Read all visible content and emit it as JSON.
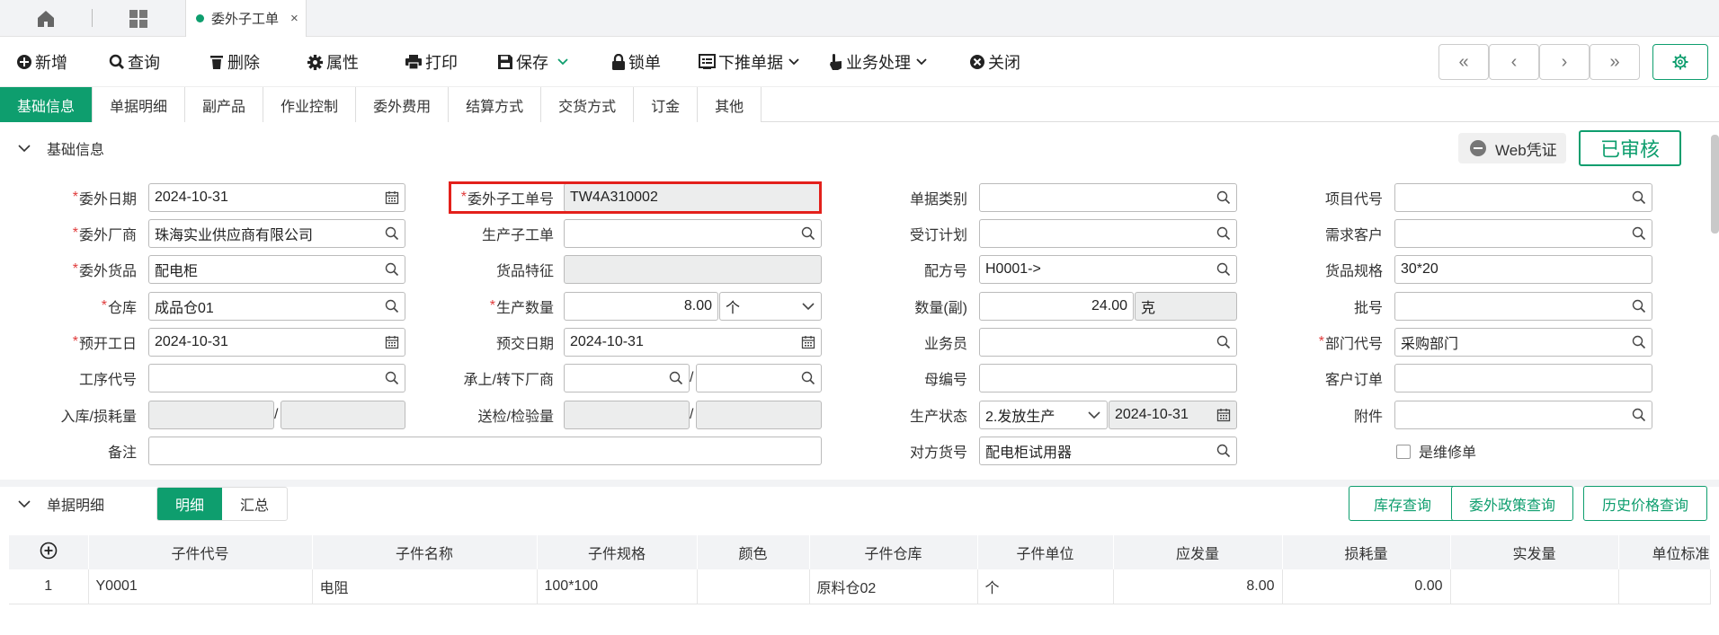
{
  "doc_tab": {
    "label": "委外子工单",
    "close": "×"
  },
  "toolbar": {
    "new": "新增",
    "query": "查询",
    "delete": "删除",
    "properties": "属性",
    "print": "打印",
    "save": "保存",
    "lock": "锁单",
    "push_down": "下推单据",
    "business": "业务处理",
    "close": "关闭"
  },
  "nav": {
    "first": "«",
    "prev": "‹",
    "next": "›",
    "last": "»"
  },
  "tabs": [
    "基础信息",
    "单据明细",
    "副产品",
    "作业控制",
    "委外费用",
    "结算方式",
    "交货方式",
    "订金",
    "其他"
  ],
  "basic": {
    "section_title": "基础信息",
    "web_voucher": "Web凭证",
    "status": "已审核",
    "required_mark": "*",
    "labels": {
      "outsource_date": "委外日期",
      "outsource_vendor": "委外厂商",
      "outsource_goods": "委外货品",
      "warehouse": "仓库",
      "planned_start": "预开工日",
      "process_code": "工序代号",
      "in_loss_qty": "入库/损耗量",
      "remark": "备注",
      "sub_order_no": "委外子工单号",
      "production_sub_order": "生产子工单",
      "goods_feature": "货品特征",
      "production_qty": "生产数量",
      "planned_delivery": "预交日期",
      "upstream_vendor": "承上/转下厂商",
      "inspect_qty": "送检/检验量",
      "doc_type": "单据类别",
      "order_plan": "受订计划",
      "formula_no": "配方号",
      "qty_secondary": "数量(副)",
      "salesman": "业务员",
      "parent_no": "母编号",
      "production_status": "生产状态",
      "counterpart_goods": "对方货号",
      "project_code": "项目代号",
      "demand_customer": "需求客户",
      "goods_spec": "货品规格",
      "batch_no": "批号",
      "dept_code": "部门代号",
      "customer_order": "客户订单",
      "attachment": "附件",
      "is_repair": "是维修单"
    },
    "values": {
      "outsource_date": "2024-10-31",
      "outsource_vendor": "珠海实业供应商有限公司",
      "outsource_goods": "配电柜",
      "warehouse": "成品仓01",
      "planned_start": "2024-10-31",
      "process_code": "",
      "sub_order_no": "TW4A310002",
      "production_sub_order": "",
      "goods_feature": "",
      "production_qty": "8.00",
      "production_unit": "个",
      "planned_delivery": "2024-10-31",
      "doc_type": "",
      "order_plan": "",
      "formula_no": "H0001->",
      "qty_secondary": "24.00",
      "secondary_unit": "克",
      "salesman": "",
      "parent_no": "",
      "production_status": "2.发放生产",
      "status_date": "2024-10-31",
      "counterpart_goods": "配电柜试用器",
      "project_code": "",
      "demand_customer": "",
      "goods_spec": "30*20",
      "batch_no": "",
      "dept_code": "采购部门",
      "customer_order": "",
      "attachment": "",
      "is_repair": false
    },
    "slash": "/"
  },
  "detail": {
    "section_title": "单据明细",
    "seg": [
      "明细",
      "汇总"
    ],
    "buttons": {
      "stock_query": "库存查询",
      "policy_query": "委外政策查询",
      "price_history": "历史价格查询"
    },
    "columns": [
      "子件代号",
      "子件名称",
      "子件规格",
      "颜色",
      "子件仓库",
      "子件单位",
      "应发量",
      "损耗量",
      "实发量",
      "单位标准"
    ],
    "rows": [
      {
        "idx": "1",
        "code": "Y0001",
        "name": "电阻",
        "spec": "100*100",
        "color": "",
        "warehouse": "原料仓02",
        "unit": "个",
        "due_qty": "8.00",
        "loss_qty": "0.00",
        "actual_qty": "",
        "unit_std": ""
      }
    ]
  },
  "colors": {
    "accent": "#0e9e6e",
    "required": "#e03c3c",
    "highlight": "#e3201b"
  }
}
